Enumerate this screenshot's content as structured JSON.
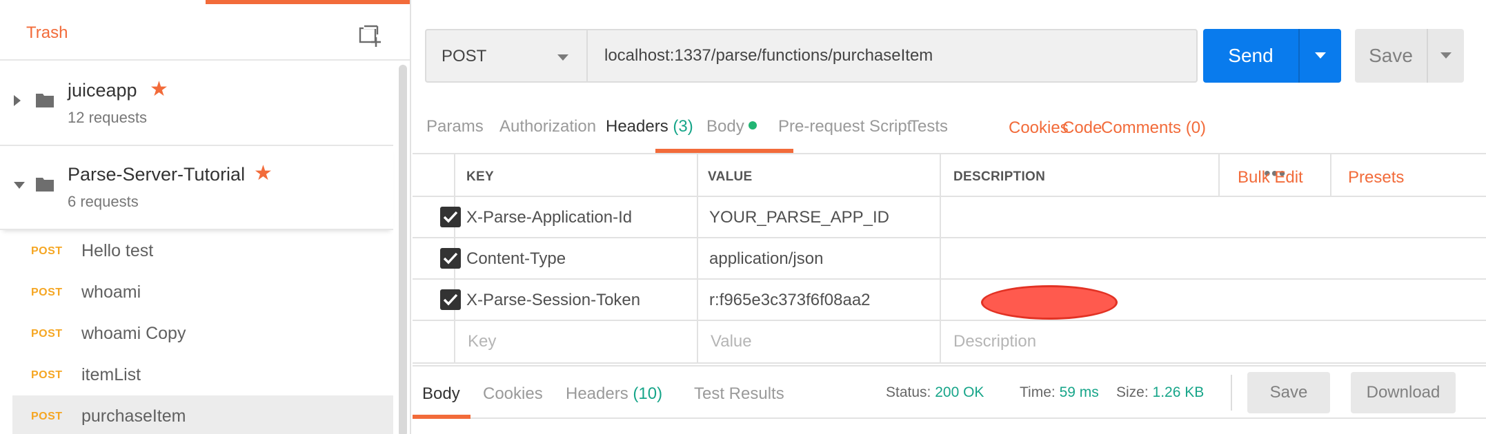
{
  "sidebar": {
    "trash_label": "Trash",
    "collections": [
      {
        "name": "juiceapp",
        "count": "12 requests",
        "starred": true,
        "expanded": false
      },
      {
        "name": "Parse-Server-Tutorial",
        "count": "6 requests",
        "starred": true,
        "expanded": true
      }
    ],
    "requests": [
      {
        "method": "POST",
        "name": "Hello test"
      },
      {
        "method": "POST",
        "name": "whoami"
      },
      {
        "method": "POST",
        "name": "whoami Copy"
      },
      {
        "method": "POST",
        "name": "itemList"
      },
      {
        "method": "POST",
        "name": "purchaseItem",
        "active": true
      }
    ],
    "star_glyph": "★"
  },
  "request": {
    "method": "POST",
    "url": "localhost:1337/parse/functions/purchaseItem",
    "send_label": "Send",
    "save_label": "Save"
  },
  "tabs": {
    "params": "Params",
    "authorization": "Authorization",
    "headers": "Headers",
    "headers_count": "(3)",
    "body": "Body",
    "prerequest": "Pre-request Script",
    "tests": "Tests",
    "cookies": "Cookies",
    "code": "Code",
    "comments": "Comments (0)"
  },
  "headers_table": {
    "col_key": "KEY",
    "col_value": "VALUE",
    "col_description": "DESCRIPTION",
    "more": "•••",
    "bulk_edit": "Bulk Edit",
    "presets": "Presets",
    "rows": [
      {
        "checked": true,
        "key": "X-Parse-Application-Id",
        "value": "YOUR_PARSE_APP_ID",
        "description": ""
      },
      {
        "checked": true,
        "key": "Content-Type",
        "value": "application/json",
        "description": ""
      },
      {
        "checked": true,
        "key": "X-Parse-Session-Token",
        "value": "r:f965e3c373f6f08aa2",
        "description": "",
        "redacted": true
      }
    ],
    "placeholder": {
      "key": "Key",
      "value": "Value",
      "description": "Description"
    }
  },
  "response": {
    "tabs": {
      "body": "Body",
      "cookies": "Cookies",
      "headers": "Headers",
      "headers_count": "(10)",
      "test_results": "Test Results"
    },
    "status_label": "Status:",
    "status_value": "200 OK",
    "time_label": "Time:",
    "time_value": "59 ms",
    "size_label": "Size:",
    "size_value": "1.26 KB",
    "save_label": "Save",
    "download_label": "Download"
  },
  "colors": {
    "accent": "#f26b3a",
    "send": "#097bed",
    "method_post": "#f5a623",
    "success": "#17a589",
    "redaction": "#ff5a4e"
  }
}
